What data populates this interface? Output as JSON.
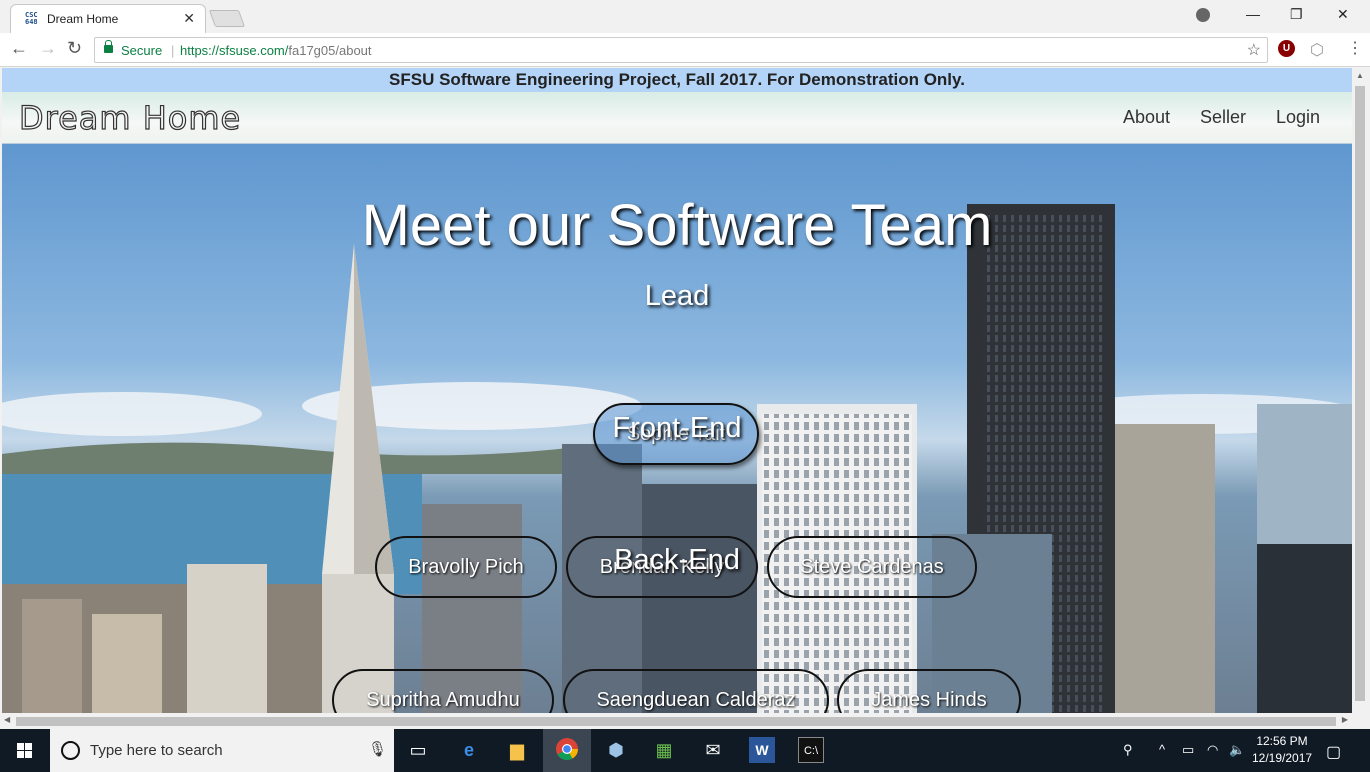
{
  "browser": {
    "tab_title": "Dream Home",
    "favicon_text": "CSC 648",
    "secure_label": "Secure",
    "url_host": "https://sfsuse.com/",
    "url_path": "fa17g05/about"
  },
  "page": {
    "banner": "SFSU Software Engineering Project, Fall 2017. For Demonstration Only.",
    "brand": "Dream Home",
    "nav": {
      "about": "About",
      "seller": "Seller",
      "login": "Login"
    },
    "hero_title": "Meet our Software Team",
    "sections": {
      "lead": {
        "heading": "Lead",
        "members": [
          "Sophie Tait"
        ]
      },
      "frontend": {
        "heading": "Front-End",
        "members": [
          "Bravolly Pich",
          "Brendan Kelly",
          "Steve Cardenas"
        ]
      },
      "backend": {
        "heading": "Back-End",
        "members": [
          "Supritha Amudhu",
          "Saengduean Calderaz",
          "James Hinds"
        ]
      }
    }
  },
  "taskbar": {
    "search_placeholder": "Type here to search",
    "time": "12:56 PM",
    "date": "12/19/2017"
  },
  "colors": {
    "banner_bg": "#b3d4f7",
    "secure_green": "#0b8043",
    "taskbar_bg": "#0f1a24"
  }
}
